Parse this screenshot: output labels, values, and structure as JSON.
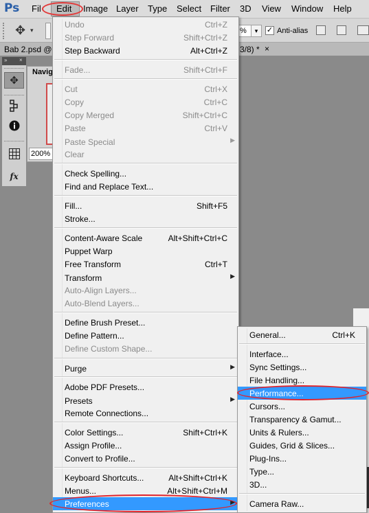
{
  "app": {
    "logo": "Ps",
    "menubar": [
      "File",
      "Edit",
      "Image",
      "Layer",
      "Type",
      "Select",
      "Filter",
      "3D",
      "View",
      "Window",
      "Help"
    ],
    "menubar_display": [
      "Fil",
      "Edit",
      "Image",
      "Layer",
      "Type",
      "Select",
      "Filter",
      "3D",
      "View",
      "Window",
      "Help"
    ]
  },
  "options_bar": {
    "percent_fragment": "%",
    "anti_alias_label": "Anti-alias",
    "anti_alias_checked": true,
    "check_glyph": "✓",
    "dropdown_glyph": "▾"
  },
  "doc_tabs": {
    "left": "Bab 2.psd @",
    "right": "3/8) *",
    "close": "×"
  },
  "navigator": {
    "title": "Navig",
    "zoom": "200%"
  },
  "toolbox": {
    "collapse_glyph": "»",
    "close_glyph": "×"
  },
  "edit_menu": {
    "items": [
      {
        "label": "Undo",
        "shortcut": "Ctrl+Z",
        "disabled": true
      },
      {
        "label": "Step Forward",
        "shortcut": "Shift+Ctrl+Z",
        "disabled": true
      },
      {
        "label": "Step Backward",
        "shortcut": "Alt+Ctrl+Z",
        "disabled": false
      },
      {
        "label": "Fade...",
        "shortcut": "Shift+Ctrl+F",
        "disabled": true
      },
      {
        "label": "Cut",
        "shortcut": "Ctrl+X",
        "disabled": true
      },
      {
        "label": "Copy",
        "shortcut": "Ctrl+C",
        "disabled": true
      },
      {
        "label": "Copy Merged",
        "shortcut": "Shift+Ctrl+C",
        "disabled": true
      },
      {
        "label": "Paste",
        "shortcut": "Ctrl+V",
        "disabled": true
      },
      {
        "label": "Paste Special",
        "shortcut": "",
        "disabled": true,
        "submenu": true
      },
      {
        "label": "Clear",
        "shortcut": "",
        "disabled": true
      },
      {
        "label": "Check Spelling...",
        "shortcut": "",
        "disabled": false
      },
      {
        "label": "Find and Replace Text...",
        "shortcut": "",
        "disabled": false
      },
      {
        "label": "Fill...",
        "shortcut": "Shift+F5",
        "disabled": false
      },
      {
        "label": "Stroke...",
        "shortcut": "",
        "disabled": false
      },
      {
        "label": "Content-Aware Scale",
        "shortcut": "Alt+Shift+Ctrl+C",
        "disabled": false
      },
      {
        "label": "Puppet Warp",
        "shortcut": "",
        "disabled": false
      },
      {
        "label": "Free Transform",
        "shortcut": "Ctrl+T",
        "disabled": false
      },
      {
        "label": "Transform",
        "shortcut": "",
        "disabled": false,
        "submenu": true
      },
      {
        "label": "Auto-Align Layers...",
        "shortcut": "",
        "disabled": true
      },
      {
        "label": "Auto-Blend Layers...",
        "shortcut": "",
        "disabled": true
      },
      {
        "label": "Define Brush Preset...",
        "shortcut": "",
        "disabled": false
      },
      {
        "label": "Define Pattern...",
        "shortcut": "",
        "disabled": false
      },
      {
        "label": "Define Custom Shape...",
        "shortcut": "",
        "disabled": true
      },
      {
        "label": "Purge",
        "shortcut": "",
        "disabled": false,
        "submenu": true
      },
      {
        "label": "Adobe PDF Presets...",
        "shortcut": "",
        "disabled": false
      },
      {
        "label": "Presets",
        "shortcut": "",
        "disabled": false,
        "submenu": true
      },
      {
        "label": "Remote Connections...",
        "shortcut": "",
        "disabled": false
      },
      {
        "label": "Color Settings...",
        "shortcut": "Shift+Ctrl+K",
        "disabled": false
      },
      {
        "label": "Assign Profile...",
        "shortcut": "",
        "disabled": false
      },
      {
        "label": "Convert to Profile...",
        "shortcut": "",
        "disabled": false
      },
      {
        "label": "Keyboard Shortcuts...",
        "shortcut": "Alt+Shift+Ctrl+K",
        "disabled": false
      },
      {
        "label": "Menus...",
        "shortcut": "Alt+Shift+Ctrl+M",
        "disabled": false
      },
      {
        "label": "Preferences",
        "shortcut": "",
        "disabled": false,
        "highlighted": true,
        "submenu": true
      }
    ]
  },
  "preferences_submenu": {
    "items": [
      {
        "label": "General...",
        "shortcut": "Ctrl+K"
      },
      {
        "label": "Interface..."
      },
      {
        "label": "Sync Settings..."
      },
      {
        "label": "File Handling..."
      },
      {
        "label": "Performance...",
        "highlighted": true
      },
      {
        "label": "Cursors..."
      },
      {
        "label": "Transparency & Gamut..."
      },
      {
        "label": "Units & Rulers..."
      },
      {
        "label": "Guides, Grid & Slices..."
      },
      {
        "label": "Plug-Ins..."
      },
      {
        "label": "Type..."
      },
      {
        "label": "3D..."
      },
      {
        "label": "Camera Raw..."
      }
    ]
  },
  "colors": {
    "highlight": "#3399ff",
    "annotation": "#e0232b",
    "menu_bg": "#f0f0f0",
    "disabled_text": "#8a8a8a"
  },
  "icons": {
    "submenu_arrow": "▶",
    "puppet_tool": "✥",
    "move_tool": "✥",
    "info": "i",
    "grid": "▦",
    "fx": "fx"
  }
}
